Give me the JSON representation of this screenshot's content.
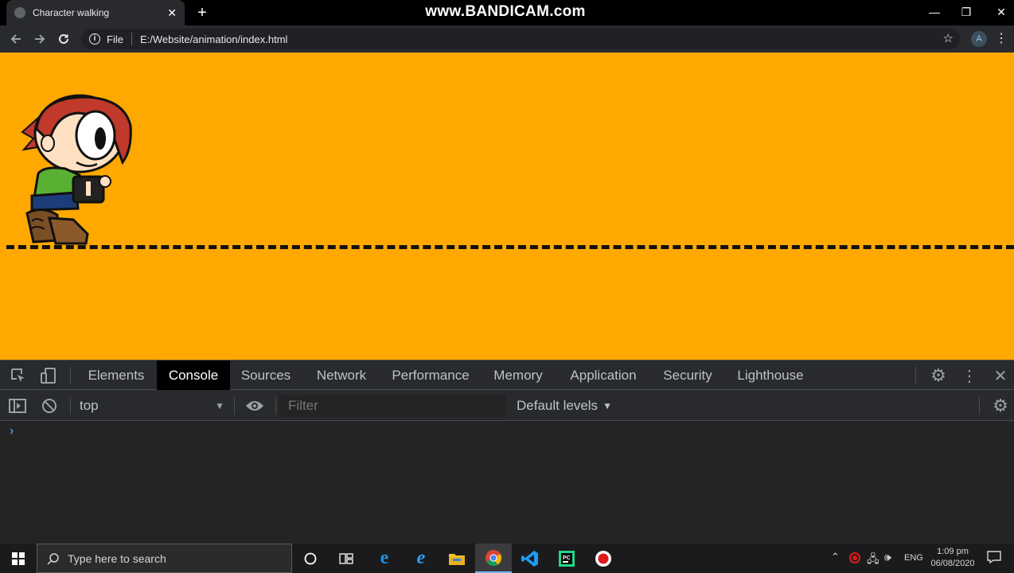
{
  "browser": {
    "tab_title": "Character walking",
    "tab_close": "✕",
    "new_tab": "+",
    "watermark": "www.BANDICAM.com",
    "window_controls": {
      "minimize": "—",
      "maximize": "❐",
      "close": "✕"
    },
    "address": {
      "scheme_label": "File",
      "url": "E:/Website/animation/index.html"
    },
    "profile_initial": "A"
  },
  "page": {
    "background_color": "#ffa800",
    "ground_line_color": "#111111"
  },
  "devtools": {
    "tabs": [
      "Elements",
      "Console",
      "Sources",
      "Network",
      "Performance",
      "Memory",
      "Application",
      "Security",
      "Lighthouse"
    ],
    "active_tab": "Console",
    "context_selector": "top",
    "filter_placeholder": "Filter",
    "levels_selector": "Default levels",
    "prompt_symbol": "›"
  },
  "taskbar": {
    "search_placeholder": "Type here to search",
    "apps": [
      "cortana",
      "task-view",
      "edge",
      "internet-explorer",
      "file-explorer",
      "chrome",
      "vscode",
      "pycharm",
      "bandicam"
    ],
    "active_app": "chrome",
    "language": "ENG",
    "time": "1:09 pm",
    "date": "06/08/2020"
  }
}
